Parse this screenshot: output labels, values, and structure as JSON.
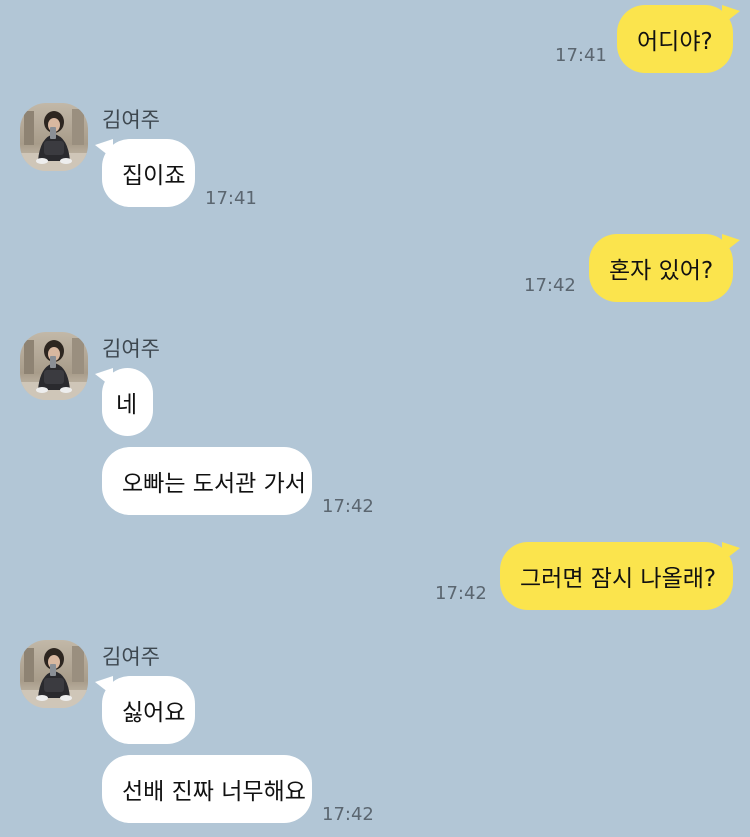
{
  "messages": {
    "m1": {
      "text": "어디야?",
      "time": "17:41"
    },
    "m2": {
      "text": "집이죠",
      "time": "17:41"
    },
    "m3": {
      "text": "혼자 있어?",
      "time": "17:42"
    },
    "m4": {
      "text": "네"
    },
    "m5": {
      "text": "오빠는 도서관 가서",
      "time": "17:42"
    },
    "m6": {
      "text": "그러면 잠시 나올래?",
      "time": "17:42"
    },
    "m7": {
      "text": "싫어요"
    },
    "m8": {
      "text": "선배 진짜 너무해요",
      "time": "17:42"
    }
  },
  "sender": {
    "name": "김여주",
    "avatar_icon": "profile-photo-person-sitting"
  },
  "colors": {
    "background": "#b2c6d6",
    "outgoing_bubble": "#fbe44d",
    "incoming_bubble": "#ffffff"
  }
}
